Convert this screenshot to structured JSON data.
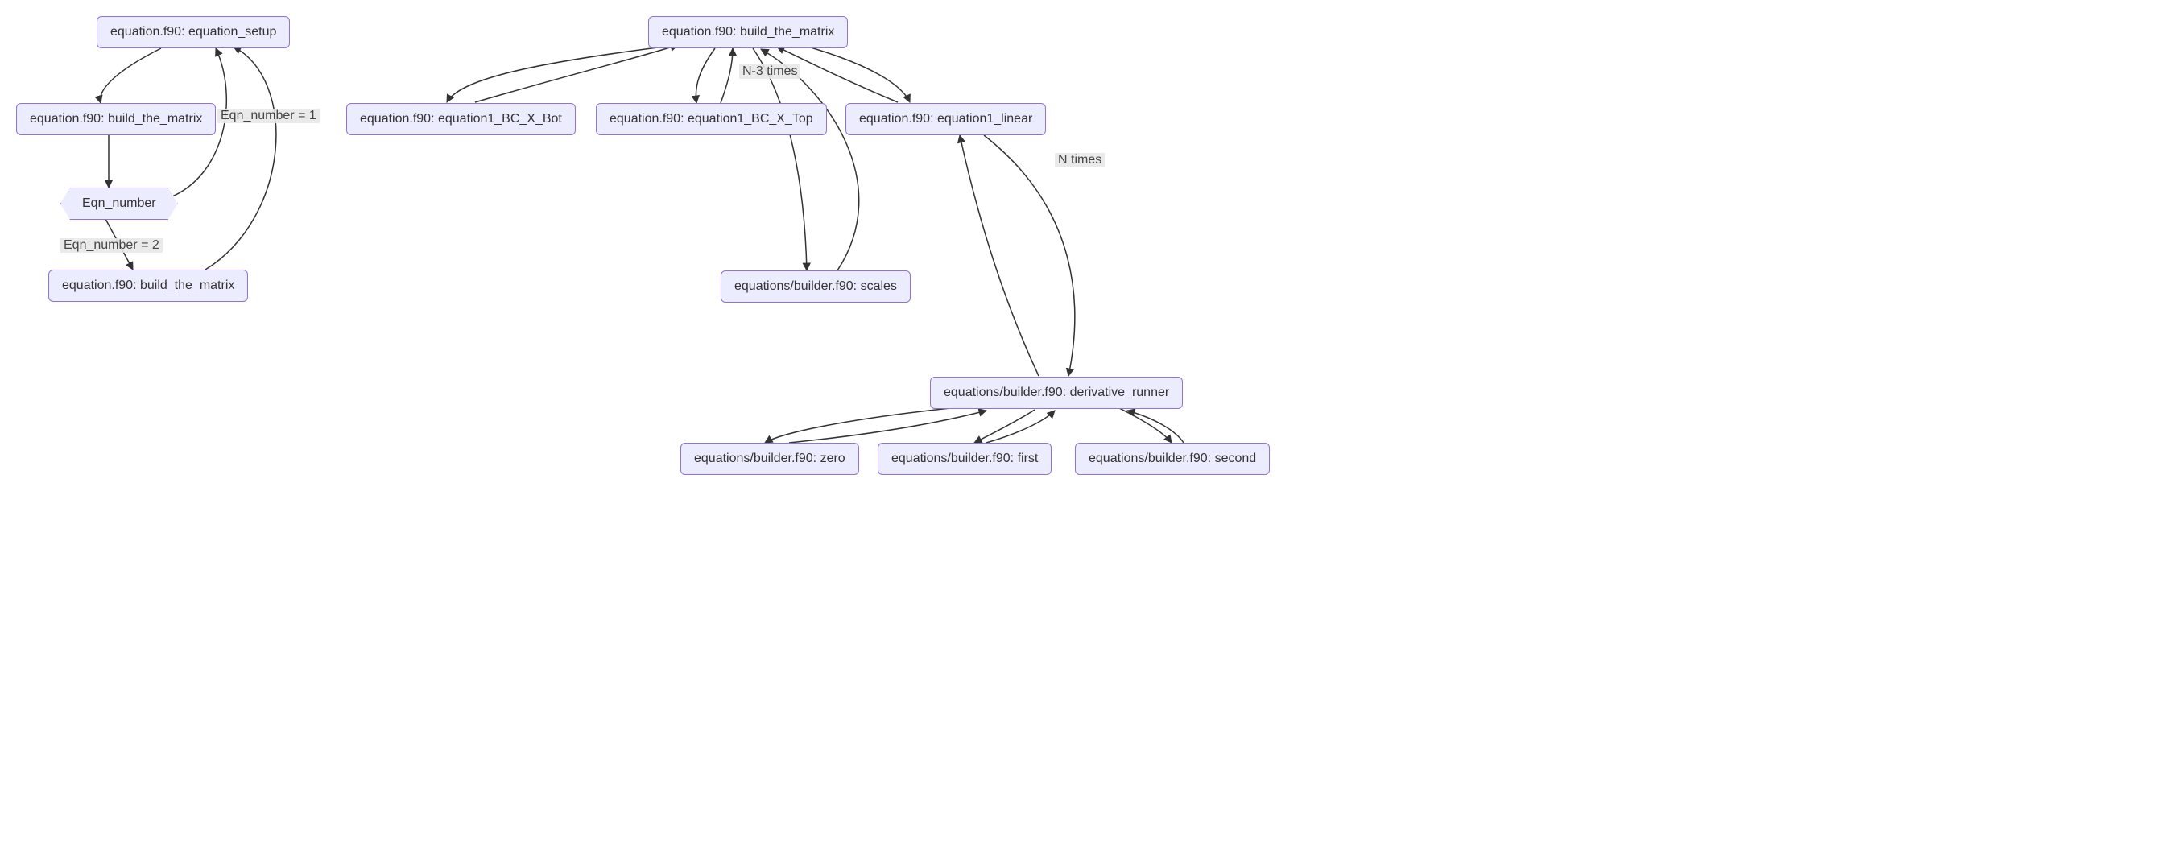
{
  "diagram_type": "flowchart",
  "colors": {
    "node_fill": "#ECECFF",
    "node_stroke": "#9370DB",
    "label_bg": "#e8e8e8",
    "text": "#333333",
    "edge": "#333333"
  },
  "left_graph": {
    "nodes": {
      "setup": {
        "label": "equation.f90: equation_setup"
      },
      "build1": {
        "label": "equation.f90: build_the_matrix"
      },
      "decision": {
        "label": "Eqn_number"
      },
      "build2": {
        "label": "equation.f90: build_the_matrix"
      }
    },
    "edges": [
      {
        "from": "setup",
        "to": "build1",
        "label": null
      },
      {
        "from": "build1",
        "to": "decision",
        "label": null
      },
      {
        "from": "decision",
        "to": "setup",
        "label": "Eqn_number = 1"
      },
      {
        "from": "decision",
        "to": "build2",
        "label": "Eqn_number = 2"
      },
      {
        "from": "build2",
        "to": "setup",
        "label": null
      }
    ]
  },
  "right_graph": {
    "nodes": {
      "build": {
        "label": "equation.f90: build_the_matrix"
      },
      "bcbot": {
        "label": "equation.f90: equation1_BC_X_Bot"
      },
      "bctop": {
        "label": "equation.f90: equation1_BC_X_Top"
      },
      "linear": {
        "label": "equation.f90: equation1_linear"
      },
      "scales": {
        "label": "equations/builder.f90: scales"
      },
      "drun": {
        "label": "equations/builder.f90: derivative_runner"
      },
      "zero": {
        "label": "equations/builder.f90: zero"
      },
      "first": {
        "label": "equations/builder.f90: first"
      },
      "second": {
        "label": "equations/builder.f90: second"
      }
    },
    "edges": [
      {
        "from": "build",
        "to": "bcbot",
        "label": null
      },
      {
        "from": "bcbot",
        "to": "build",
        "label": null
      },
      {
        "from": "build",
        "to": "bctop",
        "label": null
      },
      {
        "from": "bctop",
        "to": "build",
        "label": null
      },
      {
        "from": "build",
        "to": "linear",
        "label": "N-3 times"
      },
      {
        "from": "linear",
        "to": "build",
        "label": null
      },
      {
        "from": "build",
        "to": "scales",
        "label": null
      },
      {
        "from": "scales",
        "to": "build",
        "label": null
      },
      {
        "from": "linear",
        "to": "drun",
        "label": "N times"
      },
      {
        "from": "drun",
        "to": "linear",
        "label": null
      },
      {
        "from": "drun",
        "to": "zero",
        "label": null
      },
      {
        "from": "zero",
        "to": "drun",
        "label": null
      },
      {
        "from": "drun",
        "to": "first",
        "label": null
      },
      {
        "from": "first",
        "to": "drun",
        "label": null
      },
      {
        "from": "drun",
        "to": "second",
        "label": null
      },
      {
        "from": "second",
        "to": "drun",
        "label": null
      }
    ]
  }
}
